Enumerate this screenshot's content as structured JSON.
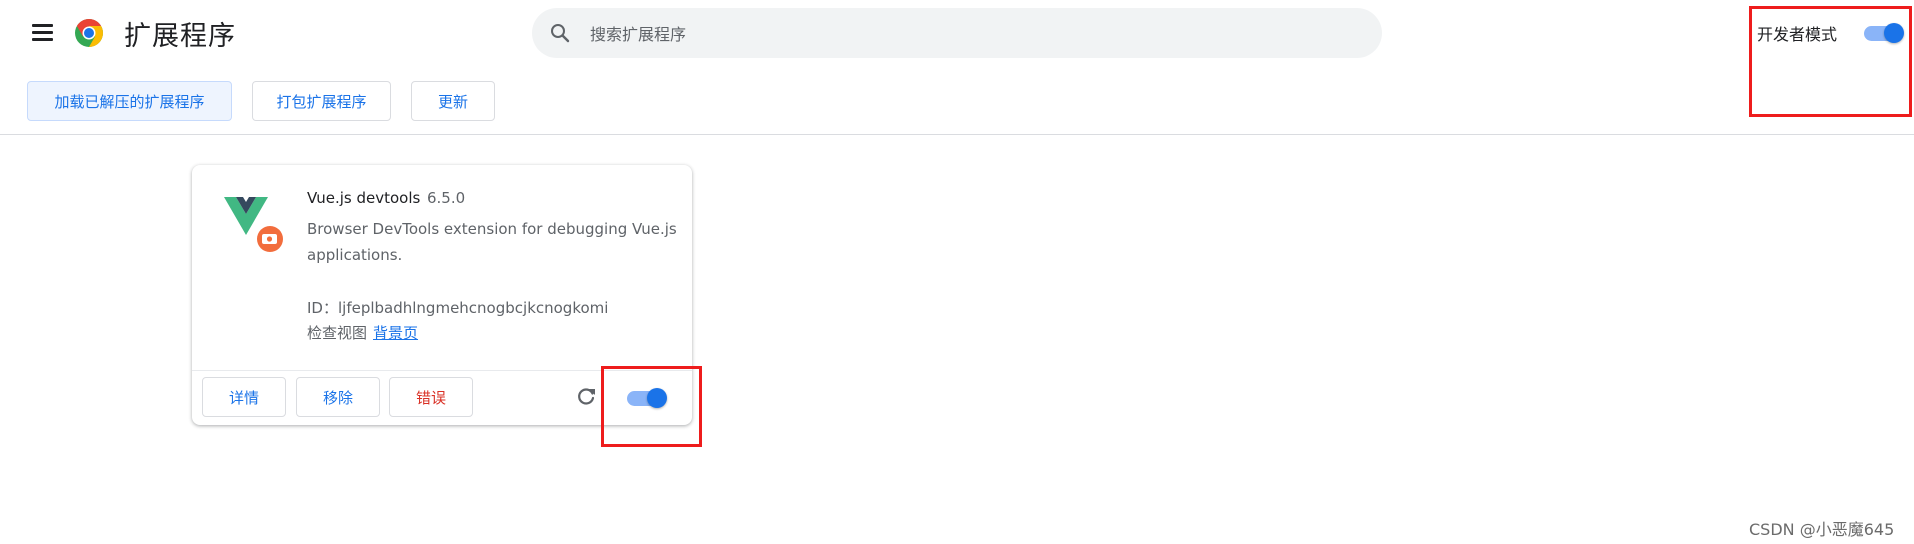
{
  "header": {
    "title": "扩展程序",
    "search_placeholder": "搜索扩展程序",
    "dev_mode_label": "开发者模式",
    "dev_mode_enabled": true
  },
  "toolbar": {
    "load_unpacked": "加载已解压的扩展程序",
    "pack": "打包扩展程序",
    "update": "更新"
  },
  "extension": {
    "name": "Vue.js devtools",
    "version": "6.5.0",
    "description": "Browser DevTools extension for debugging Vue.js applications.",
    "id_label": "ID：",
    "id": "ljfeplbadhlngmehcnogbcjkcnogkomi",
    "views_label": "检查视图",
    "views_link": "背景页",
    "enabled": true,
    "buttons": {
      "details": "详情",
      "remove": "移除",
      "errors": "错误"
    }
  },
  "icons": [
    "menu-icon",
    "chrome-logo-icon",
    "search-icon",
    "vue-devtools-icon",
    "reload-icon"
  ],
  "colors": {
    "accent": "#1a73e8",
    "toggle_track": "#8ab4f8",
    "error": "#d93025",
    "highlight_box": "#ee1c1c"
  },
  "watermark": "CSDN @小恶魔645"
}
